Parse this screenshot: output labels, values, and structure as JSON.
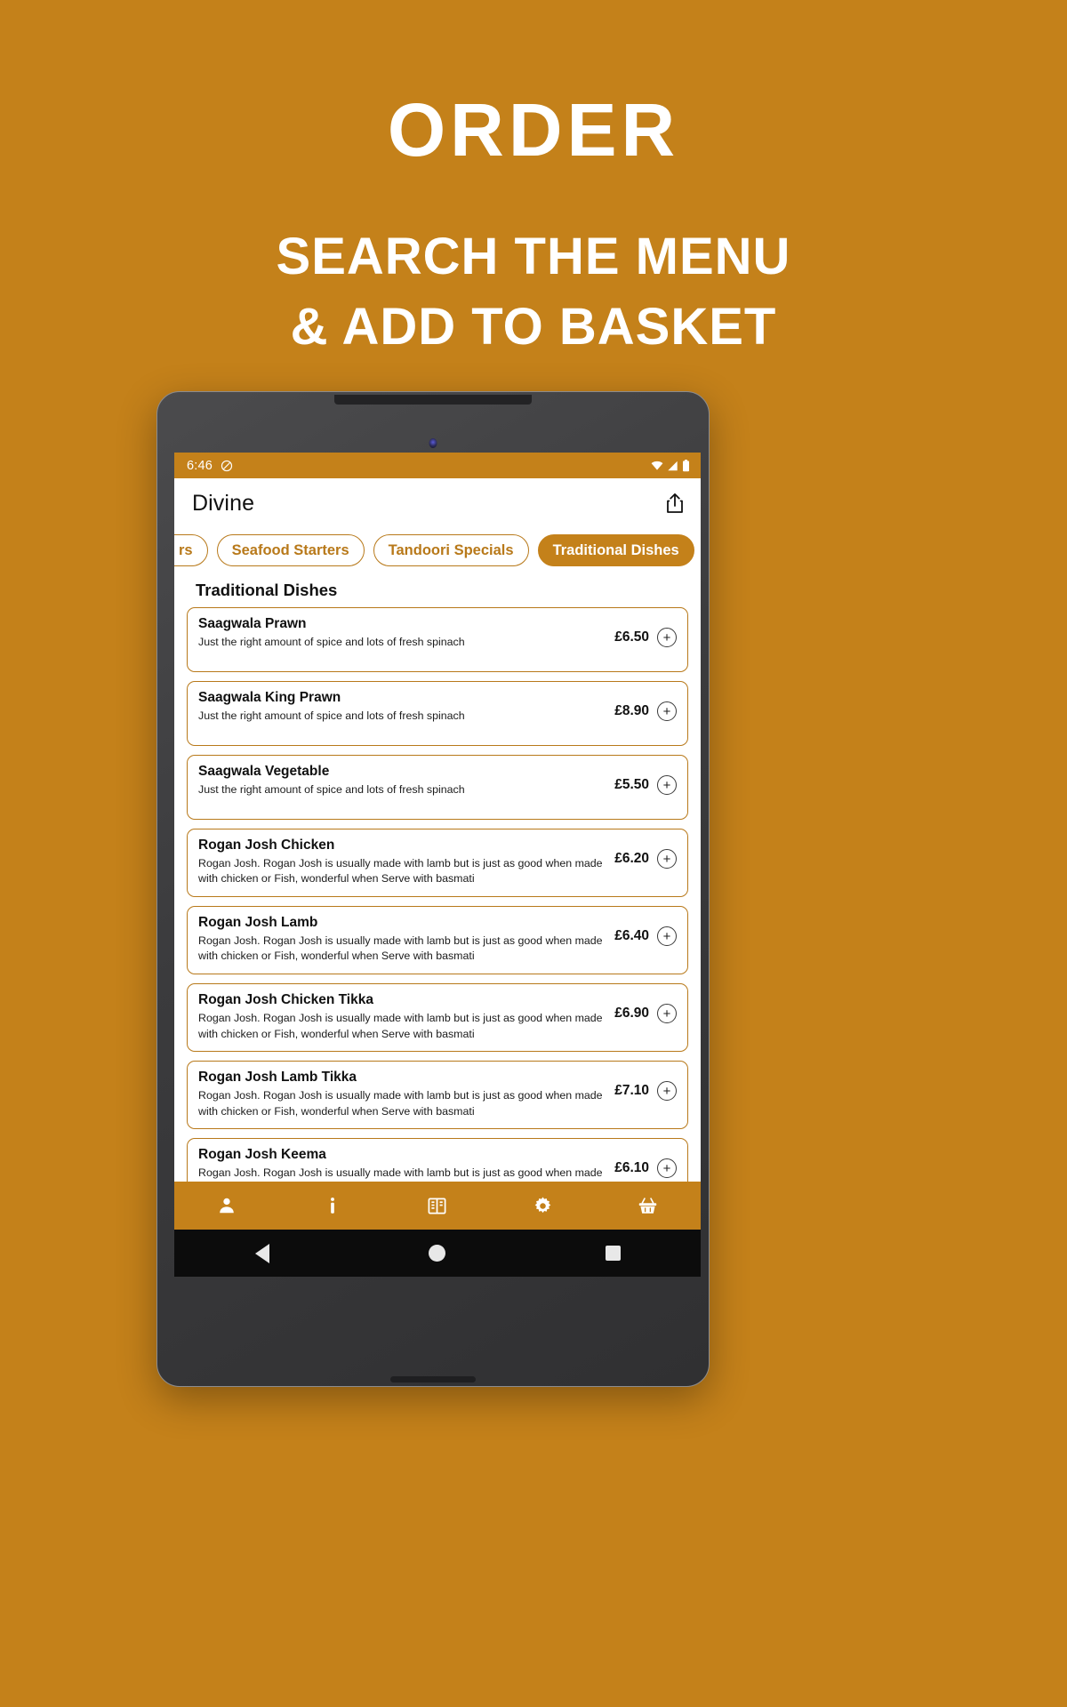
{
  "promo": {
    "title": "ORDER",
    "subtitle_line1": "SEARCH THE MENU",
    "subtitle_line2": "& ADD TO BASKET",
    "background_color": "#c4811a",
    "text_color": "#ffffff"
  },
  "device": {
    "type": "android-tablet",
    "frame_color": "#3b3b3d"
  },
  "status_bar": {
    "time": "6:46",
    "left_icons": [
      "do-not-disturb-icon"
    ],
    "right_icons": [
      "wifi-icon",
      "cellular-signal-icon",
      "battery-icon"
    ],
    "background_color": "#c4811a"
  },
  "app_bar": {
    "title": "Divine",
    "action_icon": "share-icon"
  },
  "tabs": {
    "items": [
      {
        "label": "rs",
        "active": false,
        "clipped": true
      },
      {
        "label": "Seafood Starters",
        "active": false,
        "clipped": false
      },
      {
        "label": "Tandoori Specials",
        "active": false,
        "clipped": false
      },
      {
        "label": "Traditional Dishes",
        "active": true,
        "clipped": false
      }
    ],
    "accent_color": "#b8791a",
    "active_background": "#c4811a"
  },
  "section": {
    "title": "Traditional Dishes"
  },
  "menu_items": [
    {
      "name": "Saagwala Prawn",
      "description": "Just the right amount of spice and lots of fresh spinach",
      "price": "£6.50",
      "add_label": "+"
    },
    {
      "name": "Saagwala King Prawn",
      "description": "Just the right amount of spice and lots of fresh spinach",
      "price": "£8.90",
      "add_label": "+"
    },
    {
      "name": "Saagwala Vegetable",
      "description": "Just the right amount of spice and lots of fresh spinach",
      "price": "£5.50",
      "add_label": "+"
    },
    {
      "name": "Rogan Josh Chicken",
      "description": "Rogan Josh. Rogan Josh is usually made with lamb but is just as good when made with chicken or Fish, wonderful when Serve with basmati",
      "price": "£6.20",
      "add_label": "+"
    },
    {
      "name": "Rogan Josh Lamb",
      "description": "Rogan Josh. Rogan Josh is usually made with lamb but is just as good when made with chicken or Fish, wonderful when Serve with basmati",
      "price": "£6.40",
      "add_label": "+"
    },
    {
      "name": "Rogan Josh Chicken Tikka",
      "description": "Rogan Josh. Rogan Josh is usually made with lamb but is just as good when made with chicken or Fish, wonderful when Serve with basmati",
      "price": "£6.90",
      "add_label": "+"
    },
    {
      "name": "Rogan Josh Lamb Tikka",
      "description": "Rogan Josh. Rogan Josh is usually made with lamb but is just as good when made with chicken or Fish, wonderful when Serve with basmati",
      "price": "£7.10",
      "add_label": "+"
    },
    {
      "name": "Rogan Josh Keema",
      "description": "Rogan Josh. Rogan Josh is usually made with lamb but is just as good when made with chicken or Fish, wonderful when Serve with basmati",
      "price": "£6.10",
      "add_label": "+"
    }
  ],
  "bottom_nav": {
    "background_color": "#c4811a",
    "items": [
      {
        "icon": "person-icon"
      },
      {
        "icon": "info-icon"
      },
      {
        "icon": "menu-book-icon"
      },
      {
        "icon": "gear-icon"
      },
      {
        "icon": "basket-icon"
      }
    ]
  },
  "system_nav": {
    "items": [
      {
        "icon": "back-triangle-icon"
      },
      {
        "icon": "home-circle-icon"
      },
      {
        "icon": "recents-square-icon"
      }
    ]
  }
}
